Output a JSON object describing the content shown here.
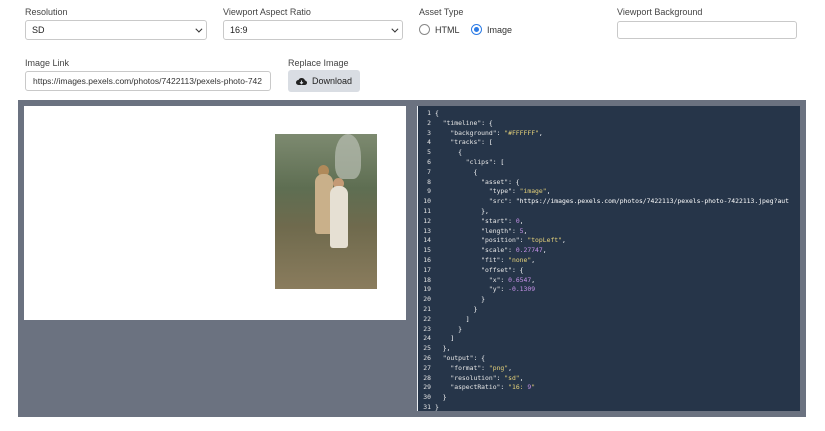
{
  "form": {
    "resolution": {
      "label": "Resolution",
      "value": "SD"
    },
    "aspect": {
      "label": "Viewport Aspect Ratio",
      "value": "16:9"
    },
    "asset_type": {
      "label": "Asset Type",
      "options": [
        {
          "label": "HTML",
          "selected": false
        },
        {
          "label": "Image",
          "selected": true
        }
      ]
    },
    "background": {
      "label": "Viewport Background",
      "value": ""
    },
    "image_link": {
      "label": "Image Link",
      "value": "https://images.pexels.com/photos/7422113/pexels-photo-742"
    },
    "replace": {
      "label": "Replace Image",
      "button": "Download"
    }
  },
  "editor": {
    "lines": [
      "{",
      "  \"timeline\": {",
      "    \"background\": \"#FFFFFF\",",
      "    \"tracks\": [",
      "      {",
      "        \"clips\": [",
      "          {",
      "            \"asset\": {",
      "              \"type\": \"image\",",
      "              \"src\": \"https://images.pexels.com/photos/7422113/pexels-photo-7422113.jpeg?aut",
      "            },",
      "            \"start\": 0,",
      "            \"length\": 5,",
      "            \"position\": \"topLeft\",",
      "            \"scale\": 0.27747,",
      "            \"fit\": \"none\",",
      "            \"offset\": {",
      "              \"x\": 0.6547,",
      "              \"y\": -0.1309",
      "            }",
      "          }",
      "        ]",
      "      }",
      "    ]",
      "  },",
      "  \"output\": {",
      "    \"format\": \"png\",",
      "    \"resolution\": \"sd\",",
      "    \"aspectRatio\": \"16:9\"",
      "  }",
      "}"
    ]
  },
  "colors": {
    "accent": "#2c7be5",
    "editor_bg": "#263549",
    "panel_bg": "#6b7280",
    "string": "#e6d27a",
    "number": "#c792ea"
  }
}
